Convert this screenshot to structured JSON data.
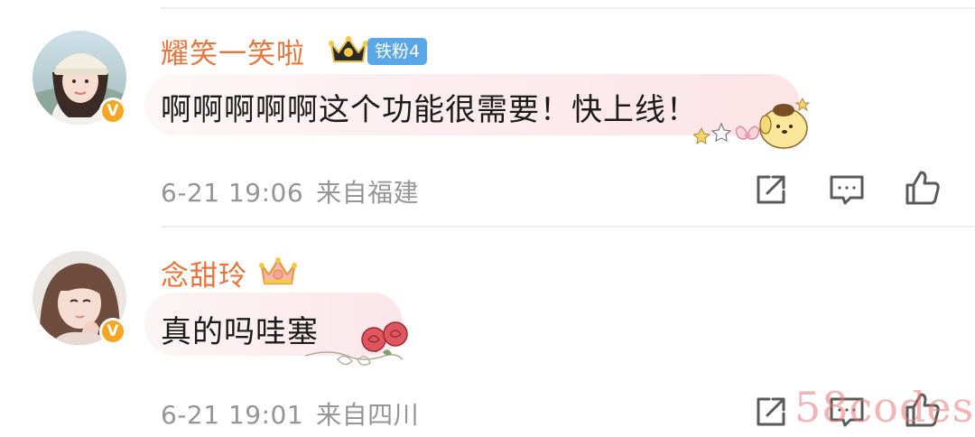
{
  "comments": [
    {
      "username": "耀笑一笑啦",
      "user_badge_icon": "crown-gold-icon",
      "fan_badge": "铁粉4",
      "verified_icon": "verified-v-icon",
      "verified_color": "#f5a623",
      "text": "啊啊啊啊啊这个功能很需要！快上线！",
      "time": "6-21 19:06",
      "location": "来自福建",
      "sticker_icon": "pompompurin-sticker-icon",
      "actions": [
        "share-icon",
        "comment-icon",
        "like-icon"
      ]
    },
    {
      "username": "念甜玲",
      "user_badge_icon": "crown-pink-icon",
      "verified_icon": "verified-v-icon",
      "verified_color": "#f5a623",
      "text": "真的吗哇塞",
      "time": "6-21 19:01",
      "location": "来自四川",
      "sticker_icon": "roses-sticker-icon",
      "actions": [
        "share-icon",
        "comment-icon",
        "like-icon"
      ]
    }
  ],
  "watermark": "58codes",
  "colors": {
    "username": "#e8743b",
    "meta": "#959595",
    "fan_badge_bg": "#5aa6e6",
    "bubble_pink": "#fce9ec"
  }
}
